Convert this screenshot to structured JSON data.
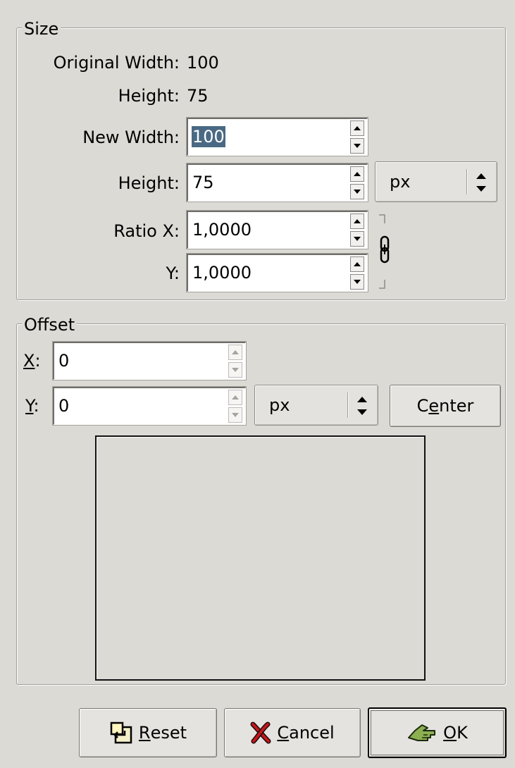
{
  "size": {
    "title": "Size",
    "original_width_label": "Original Width:",
    "original_width_value": "100",
    "original_height_label": "Height:",
    "original_height_value": "75",
    "new_width_label": "New Width:",
    "new_width_value": "100",
    "new_height_label": "Height:",
    "new_height_value": "75",
    "unit": "px",
    "ratio_x_label": "Ratio X:",
    "ratio_x_value": "1,0000",
    "ratio_y_label": "Y:",
    "ratio_y_value": "1,0000",
    "chain_icon": "chain-link-icon"
  },
  "offset": {
    "title": "Offset",
    "x_label_mnemonic": "X",
    "x_label_rest": ":",
    "x_value": "0",
    "y_label_mnemonic": "Y",
    "y_label_rest": ":",
    "y_value": "0",
    "unit": "px",
    "center_pre": "C",
    "center_mnemonic": "e",
    "center_post": "nter"
  },
  "buttons": {
    "reset_mnemonic": "R",
    "reset_rest": "eset",
    "reset_icon": "reset-icon",
    "cancel_mnemonic": "C",
    "cancel_rest": "ancel",
    "cancel_icon": "cancel-x-icon",
    "ok_mnemonic": "O",
    "ok_rest": "K",
    "ok_icon": "ok-hand-icon"
  },
  "colors": {
    "background": "#dcdad5",
    "selection": "#4a6984",
    "cancel_icon": "#c4181c",
    "ok_icon": "#6c8c3c"
  }
}
